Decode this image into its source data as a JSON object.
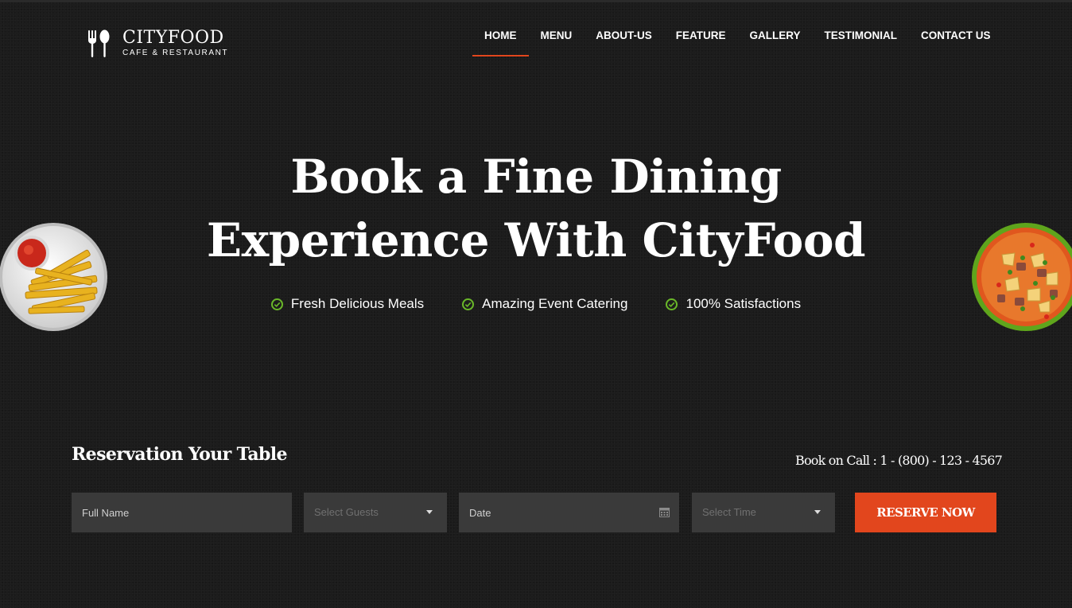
{
  "header": {
    "logo_name": "CITYFOOD",
    "logo_tagline": "CAFE & RESTAURANT",
    "nav": [
      {
        "label": "HOME",
        "active": true
      },
      {
        "label": "MENU"
      },
      {
        "label": "ABOUT-US"
      },
      {
        "label": "FEATURE"
      },
      {
        "label": "GALLERY"
      },
      {
        "label": "TESTIMONIAL"
      },
      {
        "label": "CONTACT US"
      }
    ]
  },
  "hero": {
    "title_line1": "Book a Fine Dining",
    "title_line2": "Experience With CityFood",
    "features": [
      "Fresh Delicious Meals",
      "Amazing Event Catering",
      "100% Satisfactions"
    ]
  },
  "reservation": {
    "title": "Reservation Your Table",
    "call": "Book on Call : 1 - (800) - 123 - 4567",
    "full_name_placeholder": "Full Name",
    "guests_placeholder": "Select Guests",
    "date_placeholder": "Date",
    "time_placeholder": "Select Time",
    "button": "RESERVE NOW"
  },
  "colors": {
    "accent": "#e2461d",
    "check": "#6ab829",
    "background": "#1c1c1c",
    "field": "#3a3a3a"
  },
  "icons": [
    "fork-spoon-icon",
    "check-circle-icon",
    "caret-down-icon",
    "calendar-icon"
  ]
}
